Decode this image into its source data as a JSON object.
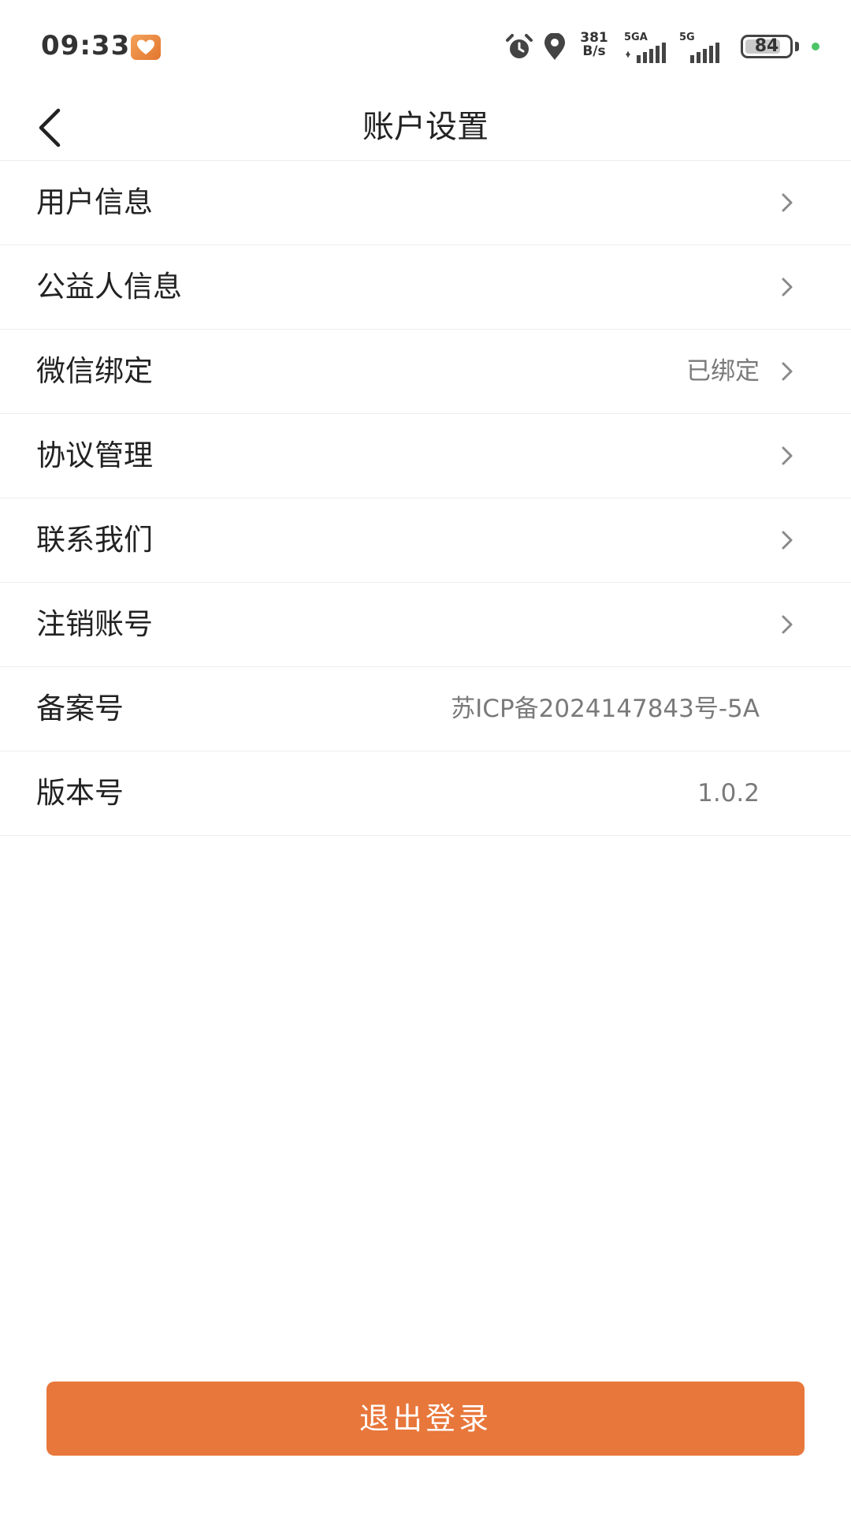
{
  "status_bar": {
    "time": "09:33",
    "net_speed_value": "381",
    "net_speed_unit": "B/s",
    "sim1_type": "5GA",
    "sim2_type": "5G",
    "battery": "84",
    "battery_level_pct": 84,
    "icons": [
      "app-badge-icon",
      "alarm-icon",
      "location-icon",
      "signal-icon",
      "battery-icon"
    ]
  },
  "header": {
    "title": "账户设置",
    "back_icon": "chevron-left-icon"
  },
  "settings": {
    "items": [
      {
        "label": "用户信息",
        "value": "",
        "has_arrow": true
      },
      {
        "label": "公益人信息",
        "value": "",
        "has_arrow": true
      },
      {
        "label": "微信绑定",
        "value": "已绑定",
        "has_arrow": true
      },
      {
        "label": "协议管理",
        "value": "",
        "has_arrow": true
      },
      {
        "label": "联系我们",
        "value": "",
        "has_arrow": true
      },
      {
        "label": "注销账号",
        "value": "",
        "has_arrow": true
      },
      {
        "label": "备案号",
        "value": "苏ICP备2024147843号-5A",
        "has_arrow": false
      },
      {
        "label": "版本号",
        "value": "1.0.2",
        "has_arrow": false
      }
    ]
  },
  "footer": {
    "logout_label": "退出登录"
  },
  "colors": {
    "accent": "#e8773b",
    "divider": "#ececec",
    "value_text": "#7a7a7a",
    "status_dot": "#4cc466"
  }
}
